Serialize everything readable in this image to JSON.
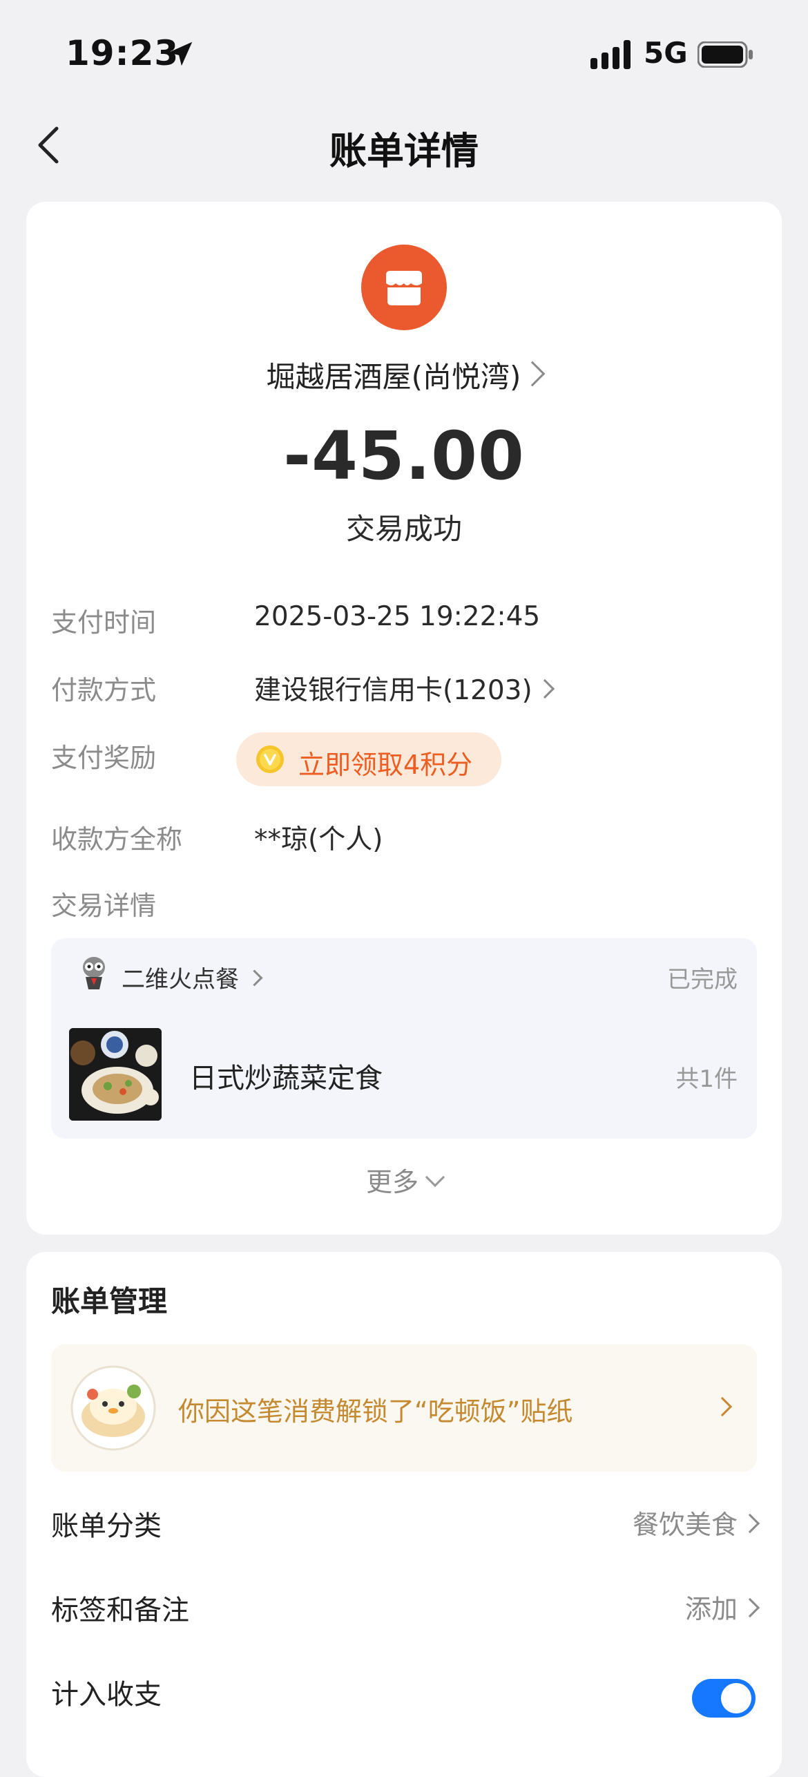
{
  "status_bar": {
    "time": "19:23",
    "network": "5G"
  },
  "nav": {
    "title": "账单详情"
  },
  "merchant": {
    "name": "堀越居酒屋(尚悦湾)"
  },
  "amount": "-45.00",
  "status": "交易成功",
  "details": {
    "pay_time": {
      "label": "支付时间",
      "value": "2025-03-25 19:22:45"
    },
    "pay_method": {
      "label": "付款方式",
      "value": "建设银行信用卡(1203)"
    },
    "reward": {
      "label": "支付奖励",
      "value": "立即领取4积分"
    },
    "payee": {
      "label": "收款方全称",
      "value": "**琼(个人)"
    },
    "trade": {
      "label": "交易详情"
    }
  },
  "order": {
    "source": "二维火点餐",
    "state": "已完成",
    "item_name": "日式炒蔬菜定食",
    "item_count": "共1件"
  },
  "more": "更多",
  "manage": {
    "title": "账单管理",
    "sticker_text": "你因这笔消费解锁了“吃顿饭”贴纸",
    "category": {
      "label": "账单分类",
      "value": "餐饮美食"
    },
    "tags": {
      "label": "标签和备注",
      "value": "添加"
    },
    "include": {
      "label": "计入收支",
      "enabled": true
    }
  },
  "colors": {
    "accent": "#1677ff",
    "merchant": "#ea5a2e",
    "reward": "#ec5e22",
    "sticker": "#c58a30"
  }
}
